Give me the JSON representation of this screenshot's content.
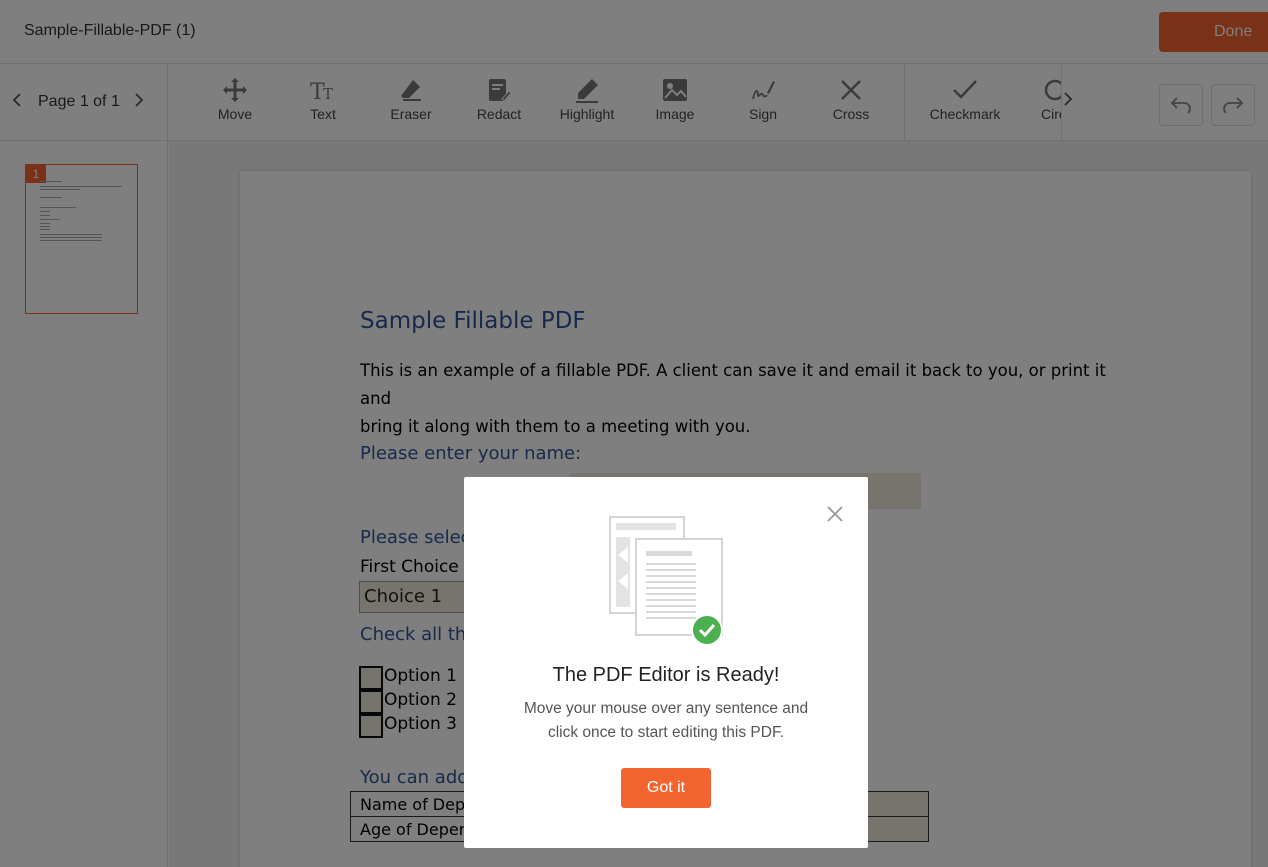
{
  "header": {
    "doc_title": "Sample-Fillable-PDF (1)",
    "done_label": "Done"
  },
  "pager": {
    "label": "Page 1 of 1"
  },
  "tools": [
    {
      "label": "Move",
      "icon": "move-icon"
    },
    {
      "label": "Text",
      "icon": "text-icon"
    },
    {
      "label": "Eraser",
      "icon": "eraser-icon"
    },
    {
      "label": "Redact",
      "icon": "redact-icon"
    },
    {
      "label": "Highlight",
      "icon": "highlight-icon"
    },
    {
      "label": "Image",
      "icon": "image-icon"
    },
    {
      "label": "Sign",
      "icon": "sign-icon"
    },
    {
      "label": "Cross",
      "icon": "cross-icon"
    },
    {
      "label": "Checkmark",
      "icon": "checkmark-icon"
    },
    {
      "label": "Circ",
      "icon": "circle-icon"
    }
  ],
  "thumbnail": {
    "page_number": "1"
  },
  "pdf": {
    "title": "Sample Fillable PDF",
    "intro_line1": "This is an example of a fillable PDF. A client can save it and email it back to you, or print it and",
    "intro_line2": "bring it along with them to a meeting with you.",
    "name_prompt": "Please enter your name:",
    "select_prompt": "Please selec",
    "first_choice_label": "First Choice",
    "select_value": "Choice 1",
    "check_prompt": "Check all tha",
    "options": [
      "Option 1",
      "Option 2",
      "Option 3"
    ],
    "add_prompt": "You can add",
    "table_rows": [
      "Name of Dep",
      "Age of Deper"
    ]
  },
  "modal": {
    "title": "The PDF Editor is Ready!",
    "message_line1": "Move your mouse over any sentence and",
    "message_line2": "click once to start editing this PDF.",
    "button_label": "Got it"
  },
  "colors": {
    "accent": "#f26530",
    "pdf_heading": "#2f5496",
    "field_fill": "#ece8da",
    "success": "#4caf50"
  }
}
